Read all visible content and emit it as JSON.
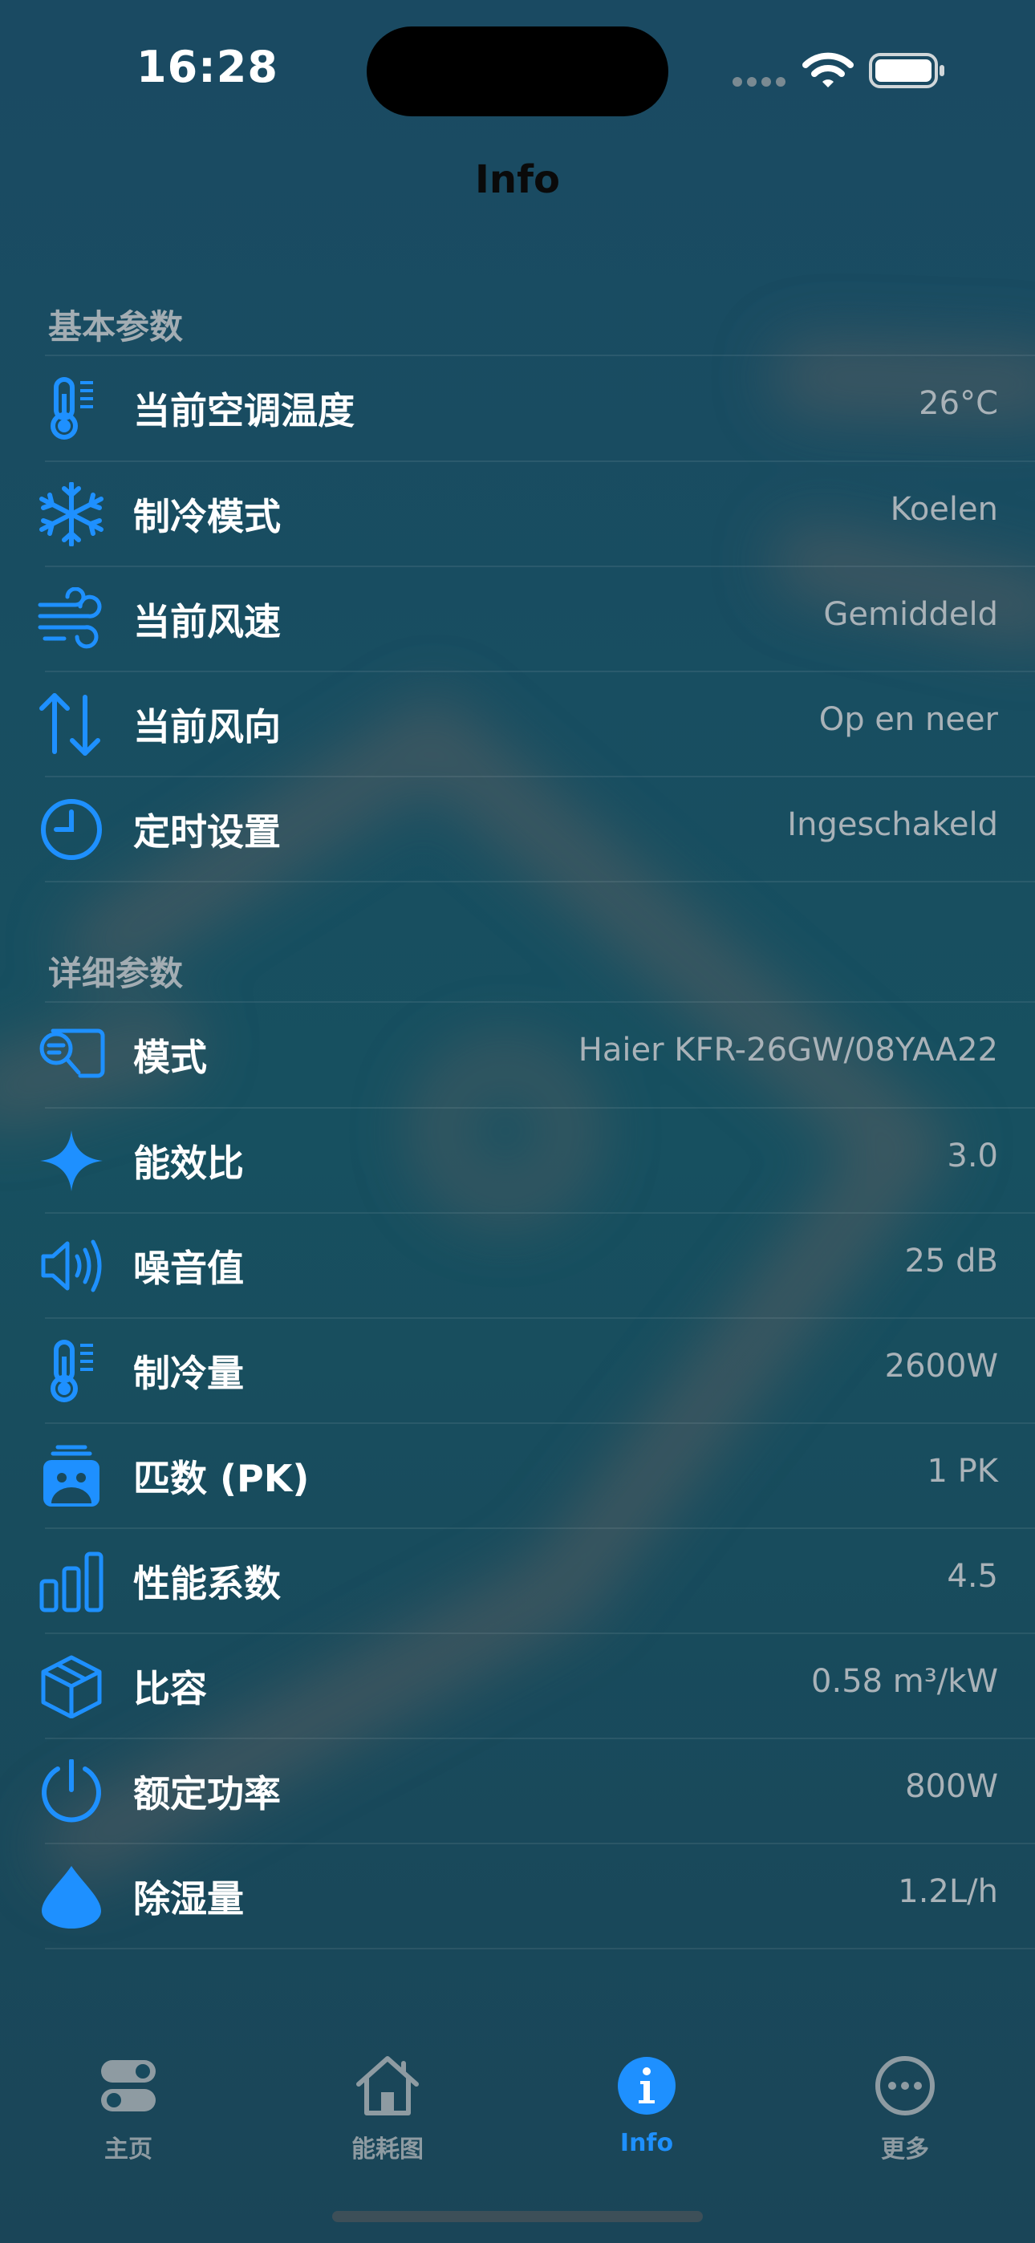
{
  "status_bar": {
    "time": "16:28"
  },
  "nav": {
    "title": "Info"
  },
  "colors": {
    "accent": "#1e90ff",
    "background": "#184a5e",
    "value_text": "#a9b2b8"
  },
  "sections": [
    {
      "header": "基本参数",
      "rows": [
        {
          "icon": "thermometer-icon",
          "label": "当前空调温度",
          "value": "26°C"
        },
        {
          "icon": "snowflake-icon",
          "label": "制冷模式",
          "value": "Koelen"
        },
        {
          "icon": "wind-icon",
          "label": "当前风速",
          "value": "Gemiddeld"
        },
        {
          "icon": "arrows-up-down-icon",
          "label": "当前风向",
          "value": "Op en neer"
        },
        {
          "icon": "clock-icon",
          "label": "定时设置",
          "value": "Ingeschakeld"
        }
      ]
    },
    {
      "header": "详细参数",
      "rows": [
        {
          "icon": "text-magnifier-icon",
          "label": "模式",
          "value": "Haier KFR-26GW/08YAA22"
        },
        {
          "icon": "sparkle-icon",
          "label": "能效比",
          "value": "3.0"
        },
        {
          "icon": "speaker-wave-icon",
          "label": "噪音值",
          "value": "25 dB"
        },
        {
          "icon": "thermometer-icon",
          "label": "制冷量",
          "value": "2600W"
        },
        {
          "icon": "air-conditioner-icon",
          "label": "匹数 (PK)",
          "value": "1 PK"
        },
        {
          "icon": "bar-chart-icon",
          "label": "性能系数",
          "value": "4.5"
        },
        {
          "icon": "cube-icon",
          "label": "比容",
          "value": "0.58 m³/kW"
        },
        {
          "icon": "power-icon",
          "label": "额定功率",
          "value": "800W"
        },
        {
          "icon": "drop-icon",
          "label": "除湿量",
          "value": "1.2L/h"
        }
      ]
    }
  ],
  "tabs": [
    {
      "icon": "toggle-icon",
      "label": "主页",
      "active": false
    },
    {
      "icon": "house-icon",
      "label": "能耗图",
      "active": false
    },
    {
      "icon": "info-circle-icon",
      "label": "Info",
      "active": true
    },
    {
      "icon": "ellipsis-circle-icon",
      "label": "更多",
      "active": false
    }
  ]
}
